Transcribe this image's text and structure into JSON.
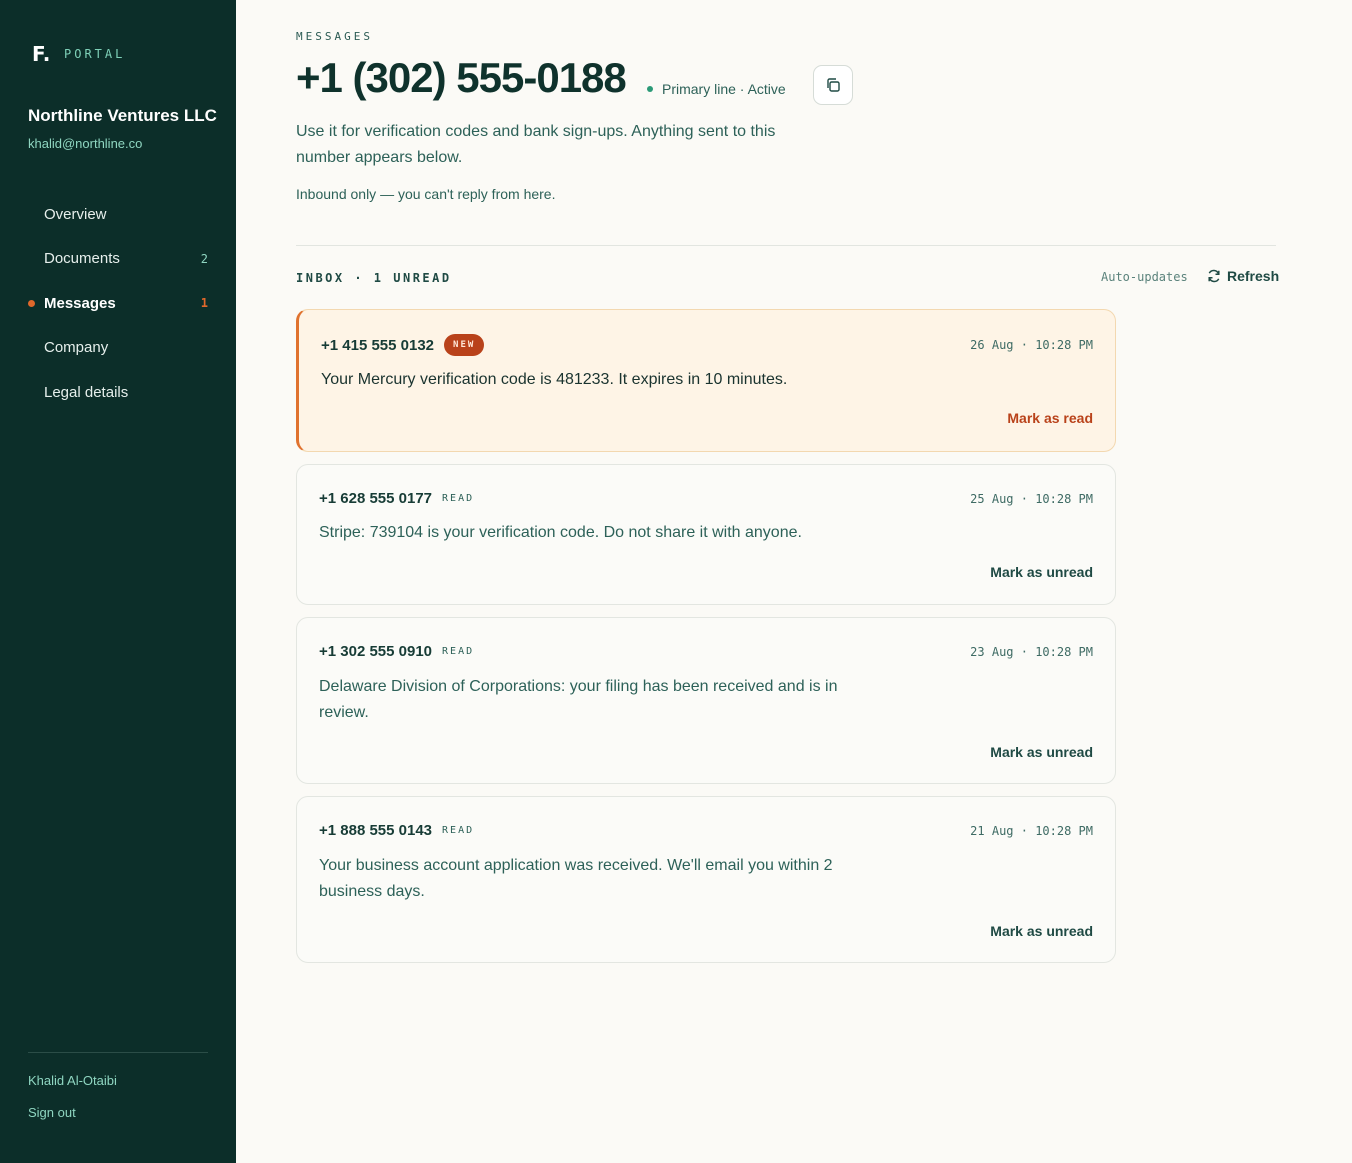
{
  "sidebar": {
    "brand_mark": "F.",
    "brand_label": "PORTAL",
    "company_name": "Northline Ventures LLC",
    "company_email": "khalid@northline.co",
    "nav": [
      {
        "label": "Overview",
        "count": ""
      },
      {
        "label": "Documents",
        "count": "2"
      },
      {
        "label": "Messages",
        "count": "1",
        "active": true
      },
      {
        "label": "Company",
        "count": ""
      },
      {
        "label": "Legal details",
        "count": ""
      }
    ],
    "user_name": "Khalid Al-Otaibi",
    "sign_out": "Sign out"
  },
  "header": {
    "eyebrow": "MESSAGES",
    "phone_number": "+1 (302) 555-0188",
    "status": "Primary line · Active",
    "description": "Use it for verification codes and bank sign-ups. Anything sent to this number appears below.",
    "inbound_note": "Inbound only — you can't reply from here."
  },
  "inbox": {
    "label": "INBOX · 1 UNREAD",
    "auto_updates": "Auto-updates",
    "refresh": "Refresh"
  },
  "messages": [
    {
      "sender": "+1 415 555 0132",
      "badge": "NEW",
      "time": "26 Aug · 10:28 PM",
      "body": "Your Mercury verification code is 481233. It expires in 10 minutes.",
      "action": "Mark as read"
    },
    {
      "sender": "+1 628 555 0177",
      "badge": "READ",
      "time": "25 Aug · 10:28 PM",
      "body": "Stripe: 739104 is your verification code. Do not share it with anyone.",
      "action": "Mark as unread"
    },
    {
      "sender": "+1 302 555 0910",
      "badge": "READ",
      "time": "23 Aug · 10:28 PM",
      "body": "Delaware Division of Corporations: your filing has been received and is in review.",
      "action": "Mark as unread"
    },
    {
      "sender": "+1 888 555 0143",
      "badge": "READ",
      "time": "21 Aug · 10:28 PM",
      "body": "Your business account application was received. We'll email you within 2 business days.",
      "action": "Mark as unread"
    }
  ],
  "colors": {
    "sidebar_bg": "#0c2e29",
    "accent_orange": "#e0682b",
    "badge_new_bg": "#b9421a",
    "unread_card_bg": "#fef4e6",
    "status_dot": "#2b9a77"
  }
}
